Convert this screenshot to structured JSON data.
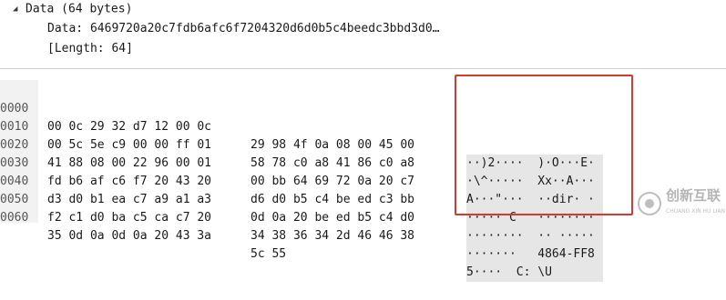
{
  "tree": {
    "header_label": "Data (64 bytes)",
    "data_field": "Data: 6469720a20c7fdb6afc6f7204320d6d0b5c4beedc3bbd3d0…",
    "length_field": "[Length: 64]"
  },
  "hex_dump": {
    "rows": [
      {
        "offset": "0000",
        "bytes_a": "00 0c 29 32 d7 12 00 0c",
        "bytes_b": "29 98 4f 0a 08 00 45 00",
        "ascii": "··)2····  )·O···E·"
      },
      {
        "offset": "0010",
        "bytes_a": "00 5c 5e c9 00 00 ff 01",
        "bytes_b": "58 78 c0 a8 41 86 c0 a8",
        "ascii": "·\\^·····  Xx··A···"
      },
      {
        "offset": "0020",
        "bytes_a": "41 88 08 00 22 96 00 01",
        "bytes_b": "00 bb 64 69 72 0a 20 c7",
        "ascii": "A···\"···  ··dir· ·"
      },
      {
        "offset": "0030",
        "bytes_a": "fd b6 af c6 f7 20 43 20",
        "bytes_b": "d6 d0 b5 c4 be ed c3 bb",
        "ascii": "····· C   ········"
      },
      {
        "offset": "0040",
        "bytes_a": "d3 d0 b1 ea c7 a9 a1 a3",
        "bytes_b": "0d 0a 20 be ed b5 c4 d0",
        "ascii": "········  ·· ·····"
      },
      {
        "offset": "0050",
        "bytes_a": "f2 c1 d0 ba c5 ca c7 20",
        "bytes_b": "34 38 36 34 2d 46 46 38",
        "ascii": "·······   4864-FF8"
      },
      {
        "offset": "0060",
        "bytes_a": "35 0d 0a 0d 0a 20 43 3a",
        "bytes_b": "5c 55",
        "ascii": "5····  C: \\U"
      }
    ]
  },
  "watermark": {
    "title": "创新互联",
    "subtitle": "CHUANG XIN HU LIAN"
  }
}
